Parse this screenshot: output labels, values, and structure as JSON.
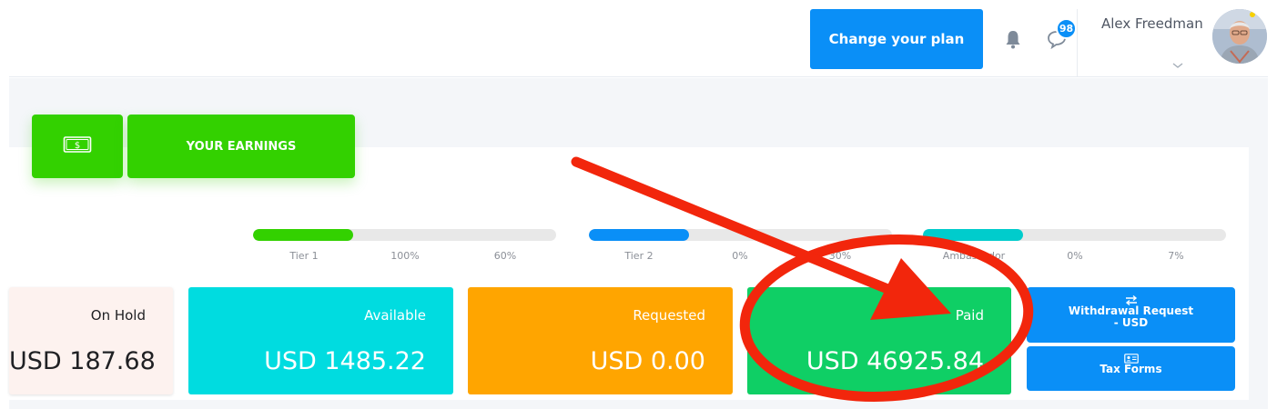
{
  "header": {
    "plan_button": "Change your plan",
    "notification_icon": "bell-icon",
    "messages_icon": "chat-bubble-icon",
    "message_badge": "98",
    "user_name": "Alex Freedman"
  },
  "earnings_tab": {
    "icon": "banknote-icon",
    "label": "YOUR EARNINGS"
  },
  "tiers": [
    {
      "name": "Tier 1",
      "current": "100%",
      "target": "60%",
      "progress": 0.33,
      "color": "#33d100"
    },
    {
      "name": "Tier 2",
      "current": "0%",
      "target": "30%",
      "progress": 0.33,
      "color": "#0a8ff7"
    },
    {
      "name": "Ambassador",
      "current": "0%",
      "target": "7%",
      "progress": 0.33,
      "color": "#00cccc"
    }
  ],
  "stats": {
    "on_hold": {
      "label": "On Hold",
      "value": "USD 187.68"
    },
    "available": {
      "label": "Available",
      "value": "USD 1485.22"
    },
    "requested": {
      "label": "Requested",
      "value": "USD 0.00"
    },
    "paid": {
      "label": "Paid",
      "value": "USD 46925.84"
    }
  },
  "actions": {
    "withdrawal_line1": "Withdrawal Request",
    "withdrawal_line2": "- USD",
    "tax_forms": "Tax Forms"
  },
  "colors": {
    "accent_blue": "#0a8ff7",
    "earnings_green": "#33d100",
    "annotation_red": "#f2260c"
  }
}
